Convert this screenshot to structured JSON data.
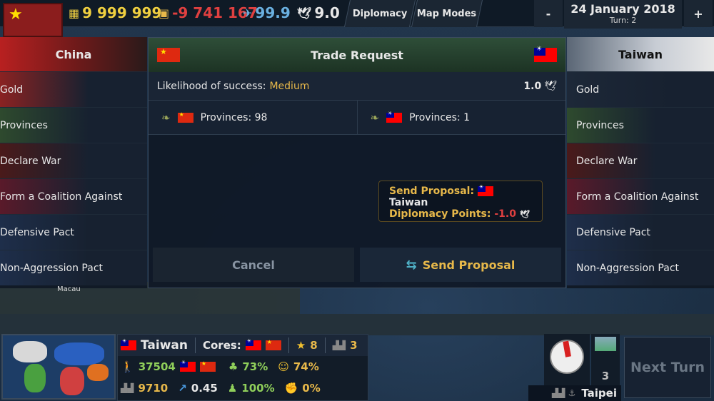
{
  "topbar": {
    "gold": "9 999 999",
    "income": "-9 741 167",
    "attack": "99.9",
    "diplomacy": "9.0",
    "diplomacy_btn": "Diplomacy",
    "map_modes_btn": "Map Modes",
    "zoom_out": "-",
    "zoom_in": "+",
    "date": "24 January 2018",
    "turn": "Turn: 2"
  },
  "left_panel": {
    "title": "China",
    "items": [
      "Gold",
      "Provinces",
      "Declare War",
      "Form a Coalition Against",
      "Defensive Pact",
      "Non-Aggression Pact"
    ]
  },
  "right_panel": {
    "title": "Taiwan",
    "items": [
      "Gold",
      "Provinces",
      "Declare War",
      "Form a Coalition Against",
      "Defensive Pact",
      "Non-Aggression Pact"
    ]
  },
  "dialog": {
    "title": "Trade Request",
    "likelihood_label": "Likelihood of success:",
    "likelihood_value": "Medium",
    "points_value": "1.0",
    "left_offer": "Provinces: 98",
    "right_offer": "Provinces: 1",
    "tooltip_send": "Send Proposal:",
    "tooltip_country": "Taiwan",
    "tooltip_points": "Diplomacy Points:",
    "tooltip_points_value": "-1.0",
    "cancel": "Cancel",
    "send": "Send Proposal"
  },
  "map_label": "Macau",
  "bottom": {
    "country": "Taiwan",
    "cores_label": "Cores:",
    "stars": "8",
    "industry": "3",
    "population": "37504",
    "growth": "73%",
    "happiness": "74%",
    "economy": "9710",
    "trend": "0.45",
    "army": "100%",
    "rebels": "0%",
    "count": "3",
    "capital": "Taipei",
    "next_turn": "Next Turn"
  },
  "colors": {
    "accent_yellow": "#e7b84a",
    "negative_red": "#e04040",
    "positive_green": "#8fce5a",
    "china_red": "#de2910",
    "taiwan_blue": "#000095"
  }
}
